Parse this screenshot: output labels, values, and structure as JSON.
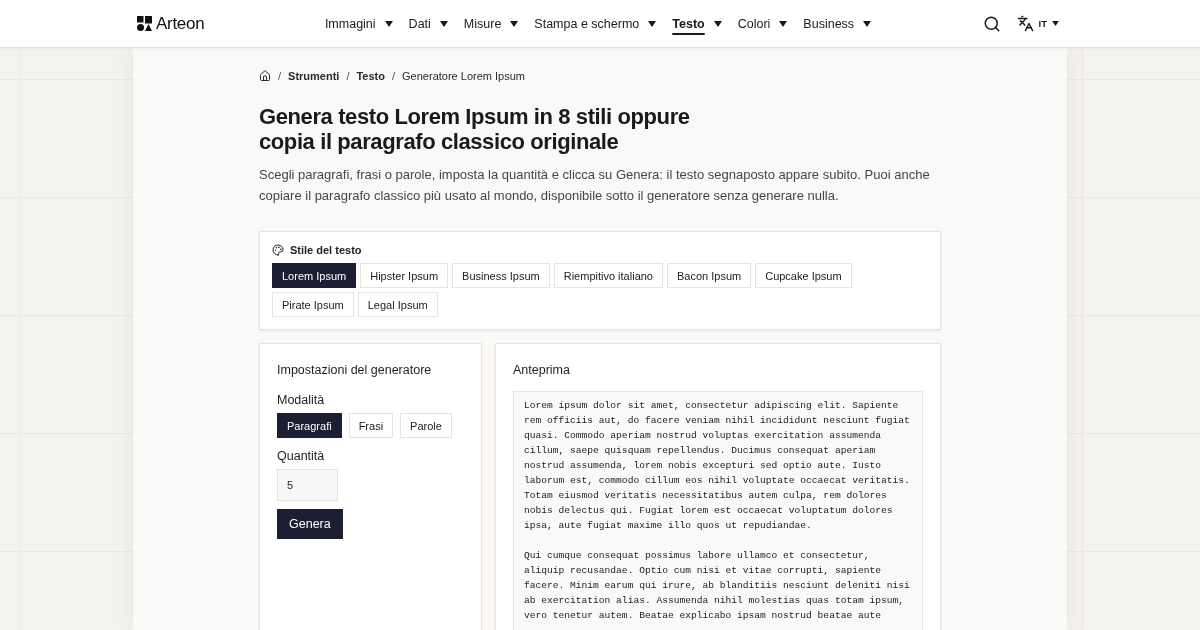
{
  "header": {
    "logo": "Arteon",
    "nav": [
      {
        "label": "Immagini",
        "selected": false
      },
      {
        "label": "Dati",
        "selected": false
      },
      {
        "label": "Misure",
        "selected": false
      },
      {
        "label": "Stampa e schermo",
        "selected": false
      },
      {
        "label": "Testo",
        "selected": true
      },
      {
        "label": "Colori",
        "selected": false
      },
      {
        "label": "Business",
        "selected": false
      }
    ],
    "language": "IT"
  },
  "breadcrumb": [
    {
      "separator": "/",
      "label": "Strumenti",
      "current": false
    },
    {
      "separator": "/",
      "label": "Testo",
      "current": false
    },
    {
      "separator": "/",
      "label": "Generatore Lorem Ipsum",
      "current": true
    }
  ],
  "title": "Genera testo Lorem Ipsum in 8 stili oppure copia il paragrafo classico originale",
  "intro": "Scegli paragrafi, frasi o parole, imposta la quantità e clicca su Genera: il testo segnaposto appare subito. Puoi anche copiare il paragrafo classico più usato al mondo, disponibile sotto il generatore senza generare nulla.",
  "style_picker": {
    "label": "Stile del testo",
    "options": [
      {
        "label": "Lorem Ipsum",
        "selected": true
      },
      {
        "label": "Hipster Ipsum",
        "selected": false
      },
      {
        "label": "Business Ipsum",
        "selected": false
      },
      {
        "label": "Riempitivo italiano",
        "selected": false
      },
      {
        "label": "Bacon Ipsum",
        "selected": false
      },
      {
        "label": "Cupcake Ipsum",
        "selected": false
      },
      {
        "label": "Pirate Ipsum",
        "selected": false
      },
      {
        "label": "Legal Ipsum",
        "selected": false
      }
    ]
  },
  "settings": {
    "title": "Impostazioni del generatore",
    "mode": {
      "label": "Modalità",
      "options": [
        {
          "label": "Paragrafi",
          "selected": true
        },
        {
          "label": "Frasi",
          "selected": false
        },
        {
          "label": "Parole",
          "selected": false
        }
      ]
    },
    "quantity": {
      "label": "Quantità",
      "value": "5"
    },
    "submit": "Genera"
  },
  "preview": {
    "title": "Anteprima",
    "paragraphs": [
      "Lorem ipsum dolor sit amet, consectetur adipiscing elit. Sapiente rem officiis aut, do facere veniam nihil incididunt nesciunt fugiat quasi. Commodo aperiam nostrud voluptas exercitation assumenda cillum, saepe quisquam repellendus. Ducimus consequat aperiam nostrud assumenda, lorem nobis excepturi sed optio aute. Iusto laborum est, commodo cillum eos nihil voluptate occaecat veritatis. Totam eiusmod veritatis necessitatibus autem culpa, rem dolores nobis delectus qui. Fugiat lorem est occaecat voluptatum dolores ipsa, aute fugiat maxime illo quos ut repudiandae.",
      "Qui cumque consequat possimus labore ullamco et consectetur, aliquip recusandae. Optio cum nisi et vitae corrupti, sapiente facere. Minim earum qui irure, ab blanditiis nesciunt deleniti nisi ab exercitation alias. Assumenda nihil molestias quas totam ipsum, vero tenetur autem. Beatae explicabo ipsam nostrud beatae aute"
    ]
  }
}
